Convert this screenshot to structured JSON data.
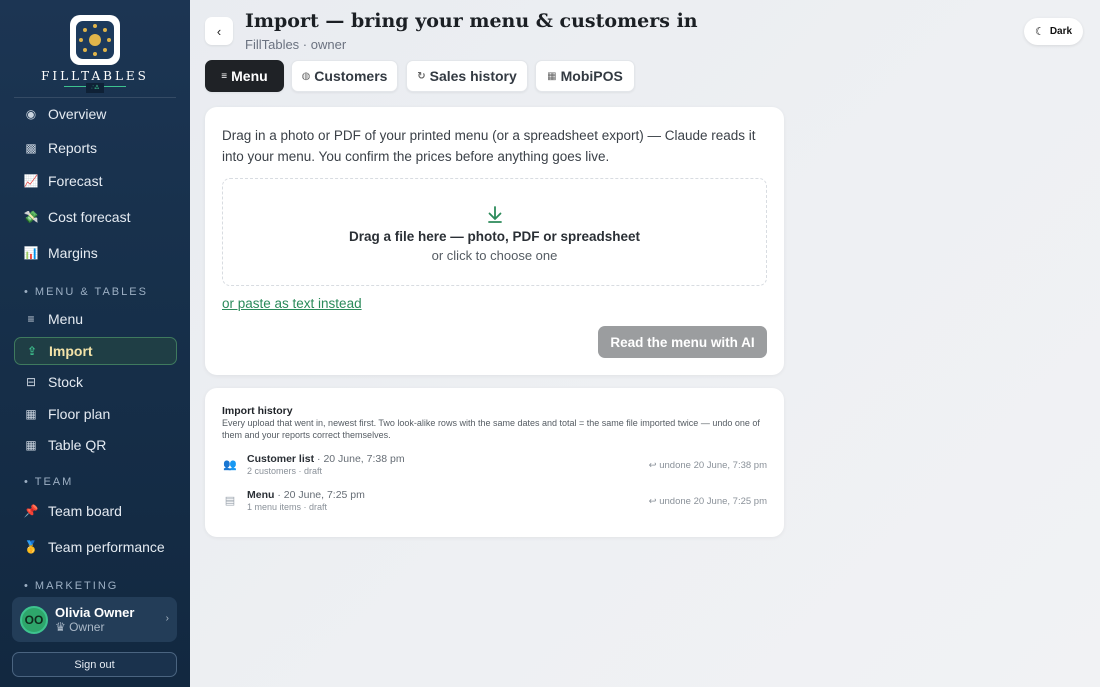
{
  "brand": {
    "name": "FILLTABLES",
    "badge": "∴∆"
  },
  "sidebar": {
    "items": [
      {
        "icon": "◉",
        "label": "Overview"
      },
      {
        "icon": "▩",
        "label": "Reports"
      },
      {
        "icon": "📈",
        "label": "Forecast"
      },
      {
        "icon": "💸",
        "label": "Cost forecast"
      },
      {
        "icon": "📊",
        "label": "Margins"
      }
    ],
    "sections": [
      "MENU & TABLES",
      "TEAM",
      "MARKETING"
    ],
    "menu_items": [
      {
        "icon": "≡",
        "label": "Menu"
      },
      {
        "icon": "⇪",
        "label": "Import"
      },
      {
        "icon": "⊟",
        "label": "Stock"
      },
      {
        "icon": "▦",
        "label": "Floor plan"
      },
      {
        "icon": "▦",
        "label": "Table QR"
      }
    ],
    "team_items": [
      {
        "icon": "📌",
        "label": "Team board"
      },
      {
        "icon": "🥇",
        "label": "Team performance"
      }
    ],
    "user": {
      "initials": "OO",
      "name": "Olivia Owner",
      "role": "♛ Owner"
    },
    "signout_label": "Sign out"
  },
  "header": {
    "back_label": "‹",
    "title": "Import — bring your menu & customers in",
    "subtitle": "FillTables · owner",
    "dark_label": "Dark"
  },
  "tabs": [
    {
      "icon": "≡",
      "label": "Menu"
    },
    {
      "icon": "◍",
      "label": "Customers"
    },
    {
      "icon": "↻",
      "label": "Sales history"
    },
    {
      "icon": "▦",
      "label": "MobiPOS"
    }
  ],
  "upload": {
    "intro": "Drag in a photo or PDF of your printed menu (or a spreadsheet export) — Claude reads it into your menu. You confirm the prices before anything goes live.",
    "drop_title": "Drag a file here — photo, PDF or spreadsheet",
    "drop_sub": "or click to choose one",
    "paste_link": "or paste as text instead",
    "read_button": "Read the menu with AI"
  },
  "history": {
    "title": "Import history",
    "description": "Every upload that went in, newest first. Two look-alike rows with the same dates and total = the same file imported twice — undo one of them and your reports correct themselves.",
    "rows": [
      {
        "icon": "👥",
        "name": "Customer list",
        "date": " · 20 June, 7:38 pm",
        "meta": "2 customers · draft",
        "undone": "↩ undone 20 June, 7:38 pm"
      },
      {
        "icon": "▤",
        "name": "Menu",
        "date": " · 20 June, 7:25 pm",
        "meta": "1 menu items · draft",
        "undone": "↩ undone 20 June, 7:25 pm"
      }
    ]
  },
  "colors": {
    "accent_green": "#2a8a5a",
    "sidebar_bg": "#17304b",
    "active_text": "#f3e3a8"
  }
}
